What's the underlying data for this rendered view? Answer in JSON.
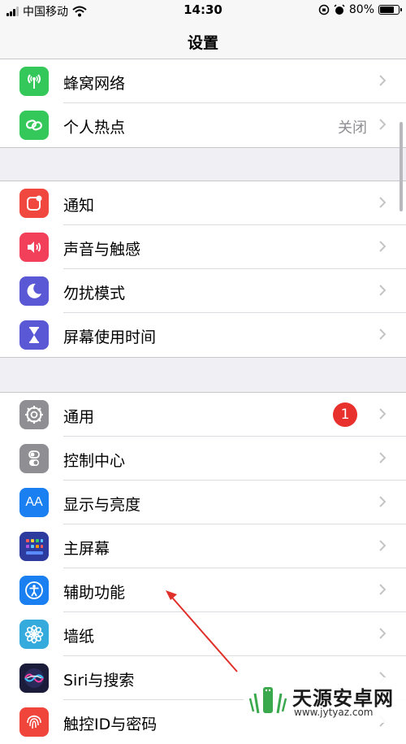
{
  "status_bar": {
    "carrier": "中国移动",
    "time": "14:30",
    "battery": "80%",
    "battery_level": 0.8
  },
  "nav": {
    "title": "设置"
  },
  "groups": [
    {
      "items": [
        {
          "label": "蜂窝网络",
          "icon": "cellular-antenna-icon",
          "color": "#34c759"
        },
        {
          "label": "个人热点",
          "icon": "hotspot-link-icon",
          "color": "#34c759",
          "value": "关闭"
        }
      ]
    },
    {
      "items": [
        {
          "label": "通知",
          "icon": "notification-icon",
          "color": "#f0483e"
        },
        {
          "label": "声音与触感",
          "icon": "speaker-icon",
          "color": "#f2405a"
        },
        {
          "label": "勿扰模式",
          "icon": "moon-icon",
          "color": "#5b58d6"
        },
        {
          "label": "屏幕使用时间",
          "icon": "hourglass-icon",
          "color": "#5b58d6"
        }
      ]
    },
    {
      "items": [
        {
          "label": "通用",
          "icon": "gear-icon",
          "color": "#8e8e93",
          "badge": "1"
        },
        {
          "label": "控制中心",
          "icon": "toggle-switches-icon",
          "color": "#8e8e93"
        },
        {
          "label": "显示与亮度",
          "icon": "text-size-icon",
          "color": "#1a7ff0",
          "icon_text": "AA"
        },
        {
          "label": "主屏幕",
          "icon": "home-grid-icon",
          "color": "#2d3a9e"
        },
        {
          "label": "辅助功能",
          "icon": "accessibility-icon",
          "color": "#1a7ff0"
        },
        {
          "label": "墙纸",
          "icon": "flower-icon",
          "color": "#35aadc"
        },
        {
          "label": "Siri与搜索",
          "icon": "siri-icon",
          "color": "#1b1b3a"
        },
        {
          "label": "触控ID与密码",
          "icon": "fingerprint-icon",
          "color": "#f0453b"
        }
      ]
    }
  ],
  "watermark": {
    "name": "天源安卓网",
    "url": "www.jytyaz.com"
  },
  "colors": {
    "badge": "#e8302d",
    "annotation_arrow": "#e0302a"
  }
}
